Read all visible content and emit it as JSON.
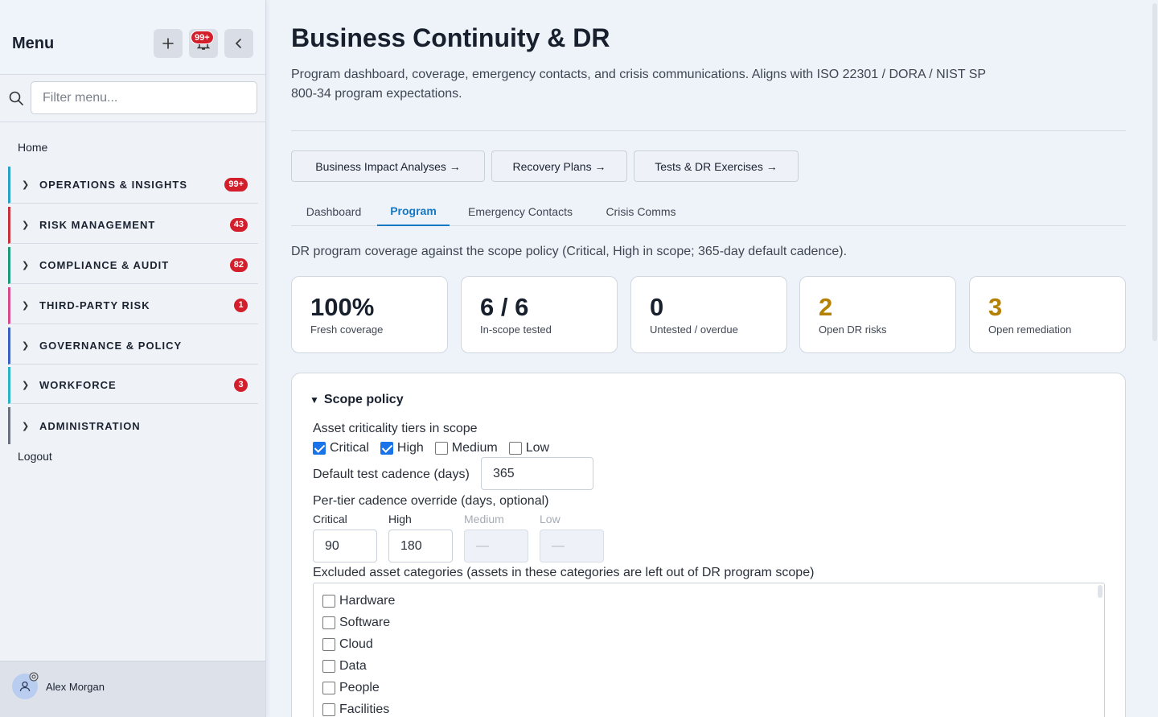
{
  "sidebar": {
    "title": "Menu",
    "notification_count": "99+",
    "filter_placeholder": "Filter menu...",
    "home": "Home",
    "groups": [
      {
        "label": "OPERATIONS & INSIGHTS",
        "count": "99+",
        "color": "#2a9fc8"
      },
      {
        "label": "RISK MANAGEMENT",
        "count": "43",
        "color": "#c8323c"
      },
      {
        "label": "COMPLIANCE & AUDIT",
        "count": "82",
        "color": "#1f9a7a"
      },
      {
        "label": "THIRD-PARTY RISK",
        "count": "1",
        "color": "#d94a8c"
      },
      {
        "label": "GOVERNANCE & POLICY",
        "count": "",
        "color": "#3d5fc4"
      },
      {
        "label": "WORKFORCE",
        "count": "3",
        "color": "#2ab3c6"
      },
      {
        "label": "ADMINISTRATION",
        "count": "",
        "color": "#6a7280"
      }
    ],
    "logout": "Logout",
    "user_name": "Alex Morgan"
  },
  "main": {
    "title": "Business Continuity & DR",
    "description": "Program dashboard, coverage, emergency contacts, and crisis communications. Aligns with ISO 22301 / DORA / NIST SP 800-34 program expectations.",
    "link_buttons": [
      "Business Impact Analyses →",
      "Recovery Plans →",
      "Tests & DR Exercises →"
    ],
    "tabs": [
      "Dashboard",
      "Program",
      "Emergency Contacts",
      "Crisis Comms"
    ],
    "active_tab": "Program",
    "coverage_text": "DR program coverage against the scope policy (Critical, High in scope; 365-day default cadence).",
    "kpis": [
      {
        "value": "100%",
        "label": "Fresh coverage"
      },
      {
        "value": "6 / 6",
        "label": "In-scope tested"
      },
      {
        "value": "0",
        "label": "Untested / overdue"
      },
      {
        "value": "2",
        "label": "Open DR risks"
      },
      {
        "value": "3",
        "label": "Open remediation"
      }
    ],
    "warn_color": "#b58105",
    "accent_color": "#1678c2"
  },
  "scope": {
    "summary": "Scope policy",
    "tiers_label": "Asset criticality tiers in scope",
    "tiers": [
      {
        "label": "Critical",
        "checked": true
      },
      {
        "label": "High",
        "checked": true
      },
      {
        "label": "Medium",
        "checked": false
      },
      {
        "label": "Low",
        "checked": false
      }
    ],
    "cadence_label": "Default test cadence (days)",
    "cadence_value": "365",
    "override_label": "Per-tier cadence override (days, optional)",
    "overrides": [
      {
        "tier": "Critical",
        "value": "90",
        "disabled": false
      },
      {
        "tier": "High",
        "value": "180",
        "disabled": false
      },
      {
        "tier": "Medium",
        "value": "—",
        "disabled": true
      },
      {
        "tier": "Low",
        "value": "—",
        "disabled": true
      }
    ],
    "excluded_label": "Excluded asset categories (assets in these categories are left out of DR program scope)",
    "categories": [
      "Hardware",
      "Software",
      "Cloud",
      "Data",
      "People",
      "Facilities"
    ]
  }
}
